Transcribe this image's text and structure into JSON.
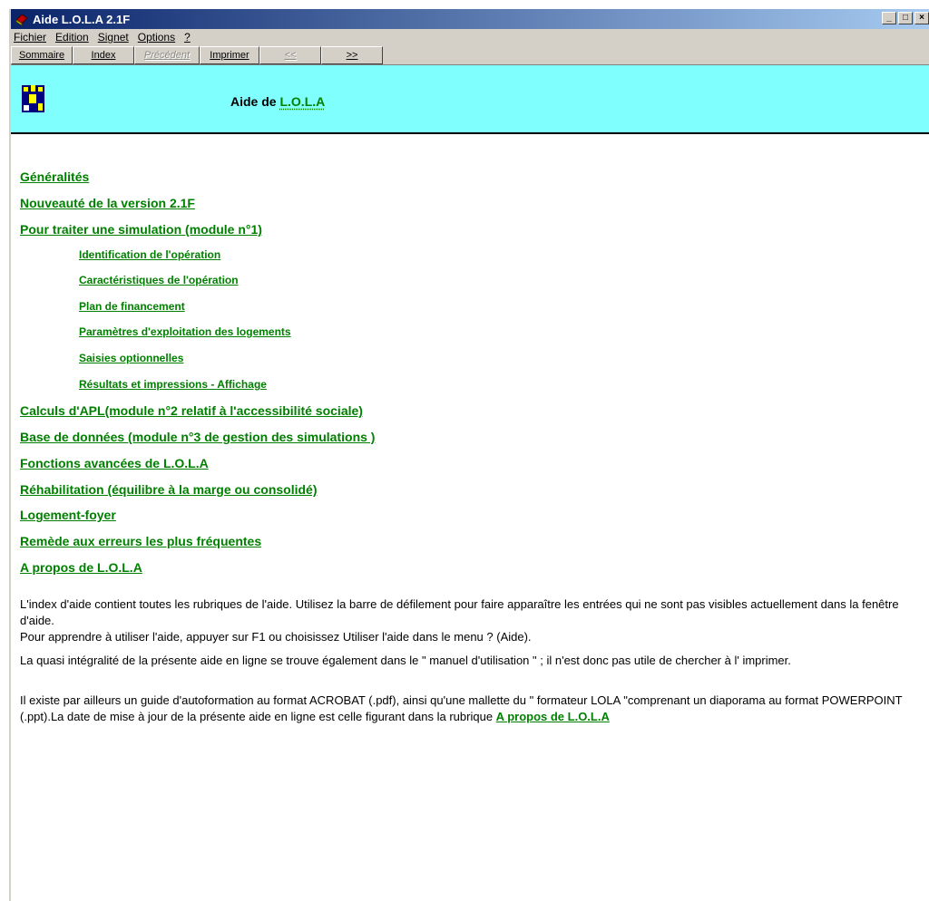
{
  "window": {
    "title": "Aide L.O.L.A 2.1F",
    "controls": [
      "_",
      "□",
      "×"
    ]
  },
  "menu": [
    "Fichier",
    "Edition",
    "Signet",
    "Options",
    "?"
  ],
  "toolbar": {
    "buttons": [
      "Sommaire",
      "Index",
      "Précédent",
      "Imprimer",
      "<<",
      ">>"
    ]
  },
  "header": {
    "prefix": "Aide de ",
    "highlight": "L.O.L.A"
  },
  "topics": [
    "Généralités",
    "Nouveauté de la version 2.1F",
    "Pour traiter une simulation (module n°1)",
    "Identification de l'opération",
    "Caractéristiques de l'opération",
    "Plan de financement",
    "Paramètres d'exploitation des logements",
    "Saisies optionnelles",
    "Résultats et impressions - Affichage",
    "Calculs d'APL(module n°2 relatif à l'accessibilité sociale)",
    "Base de données (module n°3 de gestion des simulations )",
    "Fonctions avancées de L.O.L.A",
    "Réhabilitation (équilibre à la marge ou consolidé)",
    "Logement-foyer",
    "Remède aux erreurs les plus fréquentes",
    "A propos de L.O.L.A"
  ],
  "paragraphs": {
    "p1a": "L'index d'aide contient toutes les rubriques de l'aide. Utilisez la barre de défilement pour faire apparaître les entrées qui ne sont pas visibles actuellement dans la fenêtre d'aide.",
    "p1b": "Pour apprendre à utiliser l'aide, appuyer sur F1 ou choisissez Utiliser l'aide dans le menu ? (Aide).",
    "p2": "La quasi intégralité de la présente aide en ligne se trouve également dans le \" manuel d'utilisation \" ; il n'est donc pas utile de chercher à l' imprimer.",
    "p3": "Il existe par ailleurs un guide d'autoformation au format ACROBAT (.pdf), ainsi qu'une mallette du \" formateur LOLA \"comprenant un diaporama au format POWERPOINT (.ppt).La date de mise à jour de la présente aide en ligne est celle figurant dans la rubrique ",
    "p3_link": "A propos de L.O.L.A"
  },
  "colors": {
    "link": "#008000",
    "header_bg": "#80ffff",
    "titlebar": "#0a246a"
  }
}
